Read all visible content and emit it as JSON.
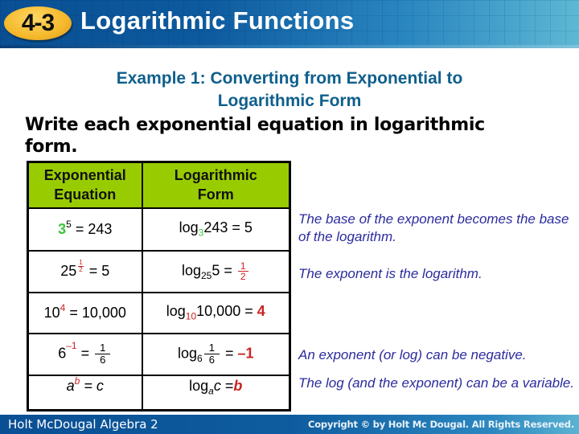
{
  "header": {
    "lesson_number": "4-3",
    "title": "Logarithmic Functions"
  },
  "example": {
    "title_line1": "Example 1: Converting from Exponential to",
    "title_line2": "Logarithmic Form",
    "instruction_line1": "Write each exponential equation in logarithmic",
    "instruction_line2": "form."
  },
  "table": {
    "headers": {
      "col1_line1": "Exponential",
      "col1_line2": "Equation",
      "col2_line1": "Logarithmic",
      "col2_line2": "Form"
    },
    "rows": [
      {
        "exp": {
          "base": "3",
          "power": "5",
          "rest": " = 243"
        },
        "log": {
          "prefix": "log",
          "base": "3",
          "arg": "243 = 5"
        }
      },
      {
        "exp": {
          "base": "25",
          "power_num": "1",
          "power_den": "2",
          "rest": " = 5"
        },
        "log": {
          "prefix": "log",
          "base": "25",
          "arg": "5 = ",
          "result_num": "1",
          "result_den": "2"
        }
      },
      {
        "exp": {
          "base": "10",
          "power": "4",
          "rest": " = 10,000"
        },
        "log": {
          "prefix": "log",
          "base": "10",
          "arg": "10,000 = ",
          "result": "4"
        }
      },
      {
        "exp": {
          "base": "6",
          "power": "–1",
          "eq": " = ",
          "frac_num": "1",
          "frac_den": "6"
        },
        "log": {
          "prefix": "log",
          "base": "6",
          "frac_num": "1",
          "frac_den": "6",
          "eq": " = ",
          "result": "–1"
        }
      },
      {
        "exp": {
          "base": "a",
          "power": "b",
          "rest": " = c"
        },
        "log": {
          "prefix": "log",
          "base": "a",
          "arg": "c",
          "eq": " =",
          "result": "b"
        }
      }
    ]
  },
  "notes": [
    "The base of the exponent becomes the base of the logarithm.",
    "The exponent is the logarithm.",
    "An exponent (or log) can be negative.",
    "The log (and the exponent) can be a variable."
  ],
  "footer": {
    "left": "Holt McDougal Algebra 2",
    "right": "Copyright © by Holt Mc Dougal. All Rights Reserved."
  },
  "colors": {
    "header_blue": "#0a4f93",
    "badge_gold": "#f5b82a",
    "example_title": "#0f5f8c",
    "table_header_green": "#99cc00",
    "note_text": "#2b2b9e",
    "highlight_red": "#cc2222",
    "highlight_green": "#3cc43c"
  }
}
